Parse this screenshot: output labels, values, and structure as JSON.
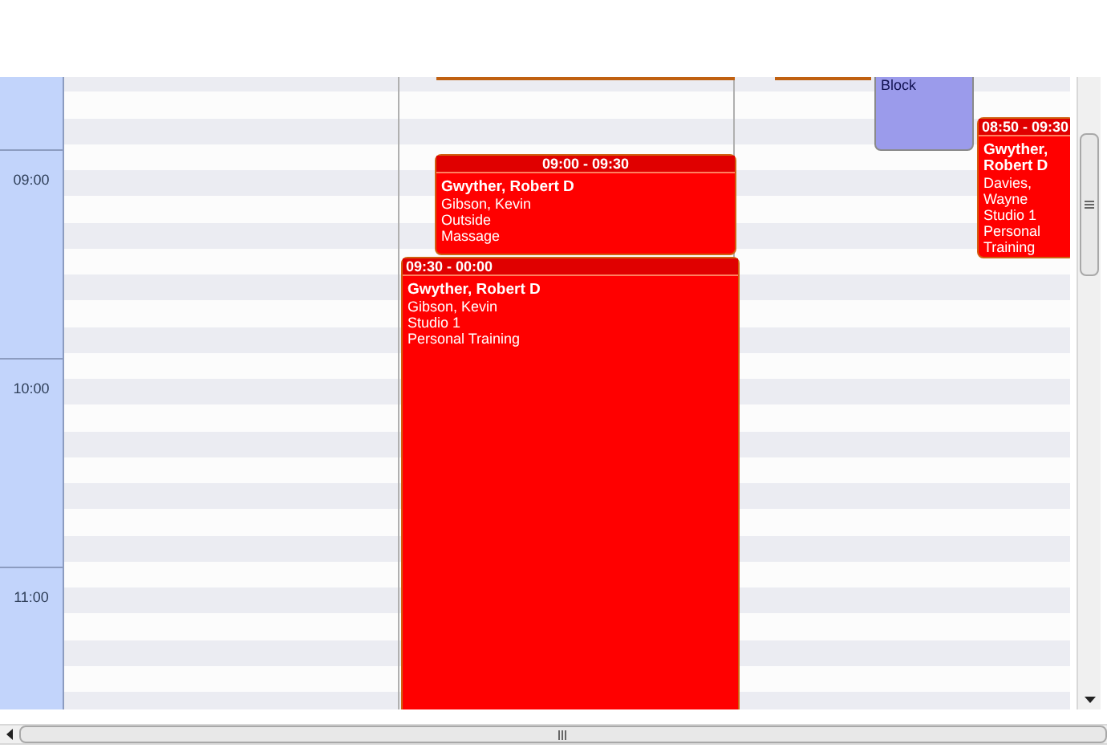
{
  "time_labels": [
    "09:00",
    "10:00",
    "11:00"
  ],
  "events": [
    {
      "kind": "block",
      "color": "#9b9beb",
      "lines": [
        "Block"
      ]
    },
    {
      "kind": "appointment",
      "color": "#ff0000",
      "time": "09:00 - 09:30",
      "client": "Gwyther, Robert D",
      "lines": [
        "Gibson, Kevin",
        "Outside",
        "Massage"
      ]
    },
    {
      "kind": "appointment",
      "color": "#ff0000",
      "time": "09:30 - 00:00",
      "client": "Gwyther, Robert D",
      "lines": [
        "Gibson, Kevin",
        "Studio 1",
        "Personal Training"
      ]
    },
    {
      "kind": "appointment",
      "color": "#ff0000",
      "time": "08:50 - 09:30",
      "client": "Gwyther, Robert D",
      "lines": [
        "Davies, Wayne",
        "Studio 1",
        "Personal Training"
      ]
    }
  ]
}
